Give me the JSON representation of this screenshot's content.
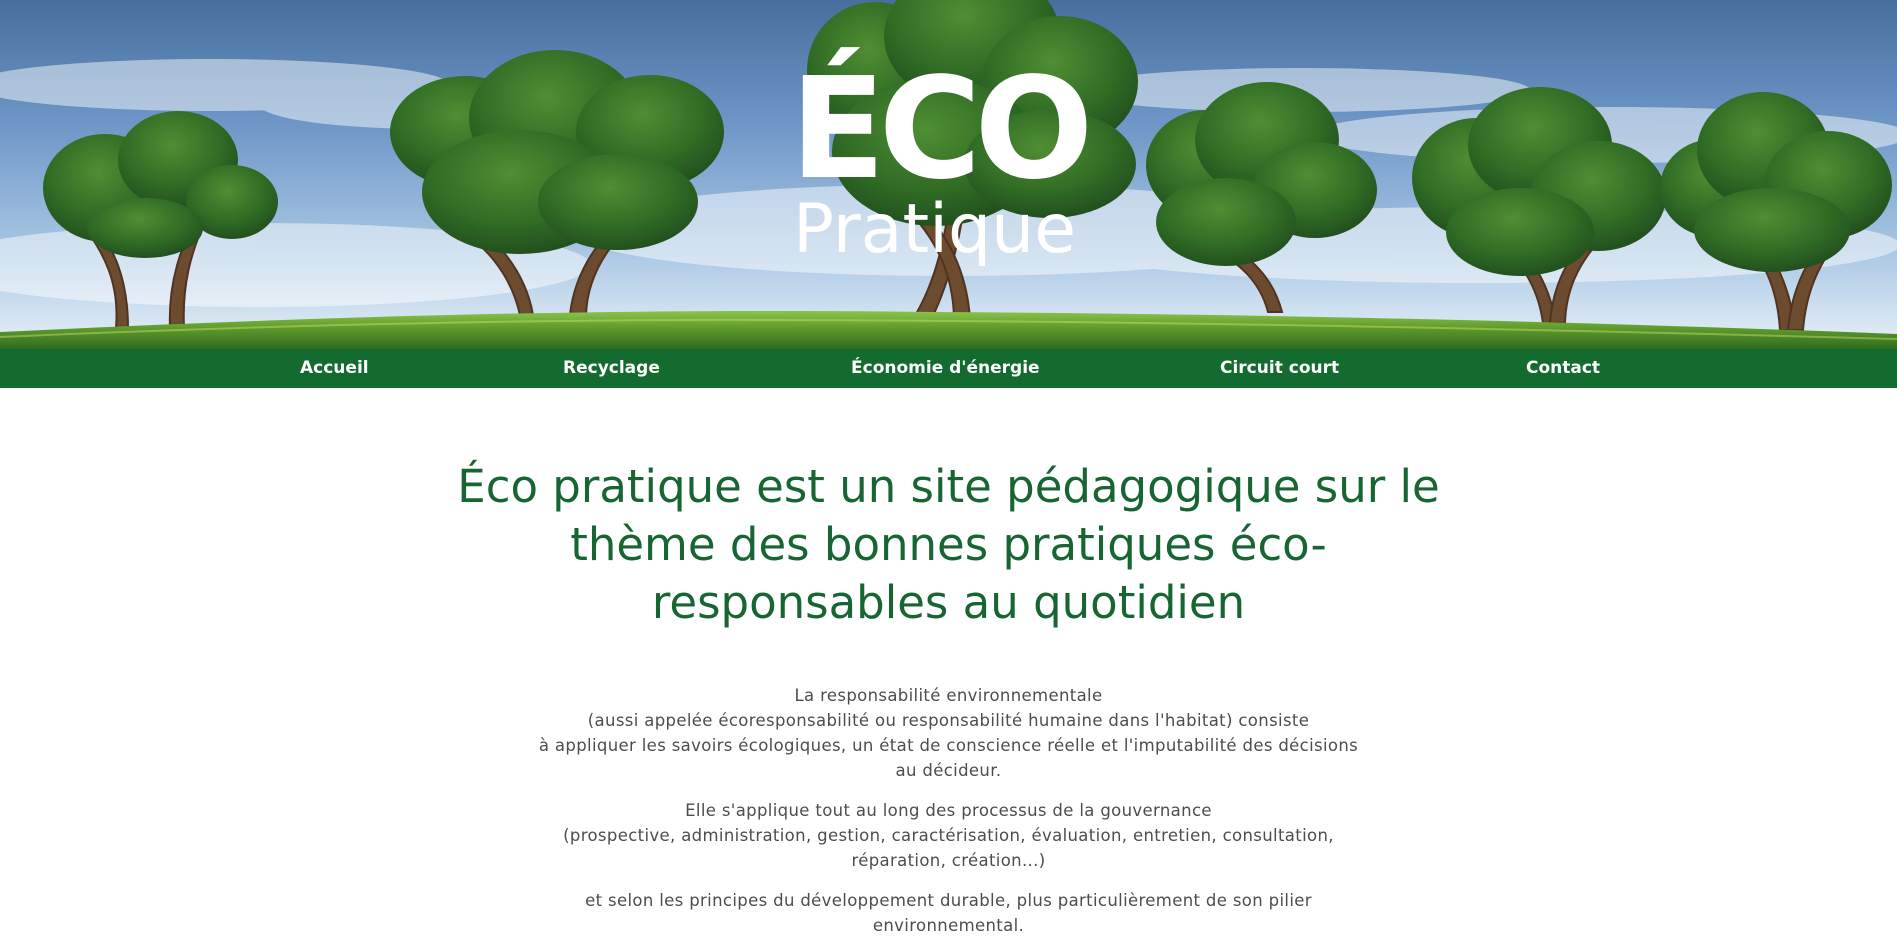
{
  "hero": {
    "logo": {
      "primary": "ÉCO",
      "secondary": "Pratique"
    },
    "image": {
      "subject": "trees-on-green-hill",
      "sky_color": "#6c98c7",
      "grass_color": "#5f9a2c",
      "tree_color": "#2f6b24"
    }
  },
  "navigation": {
    "background_color": "#146b2f",
    "text_color": "#ffffff",
    "items": [
      {
        "label": "Accueil"
      },
      {
        "label": "Recyclage"
      },
      {
        "label": "Économie d'énergie"
      },
      {
        "label": "Circuit court"
      },
      {
        "label": "Contact"
      }
    ]
  },
  "main": {
    "title_color": "#176533",
    "title_lines": [
      "Éco pratique est un site pédagogique sur le",
      "thème des bonnes pratiques éco-",
      "responsables au quotidien"
    ],
    "text_color": "#4d4d4d",
    "paragraphs": [
      {
        "lines": [
          "La responsabilité environnementale",
          "(aussi appelée écoresponsabilité ou responsabilité humaine dans l'habitat) consiste",
          "à appliquer les savoirs écologiques, un état de conscience réelle et l'imputabilité des décisions",
          "au décideur."
        ]
      },
      {
        "lines": [
          "Elle s'applique tout au long des processus de la gouvernance",
          "(prospective, administration, gestion, caractérisation, évaluation, entretien, consultation,",
          "réparation, création...)"
        ]
      },
      {
        "lines": [
          "et selon les principes du développement durable, plus particulièrement de son pilier",
          "environnemental."
        ]
      }
    ]
  }
}
